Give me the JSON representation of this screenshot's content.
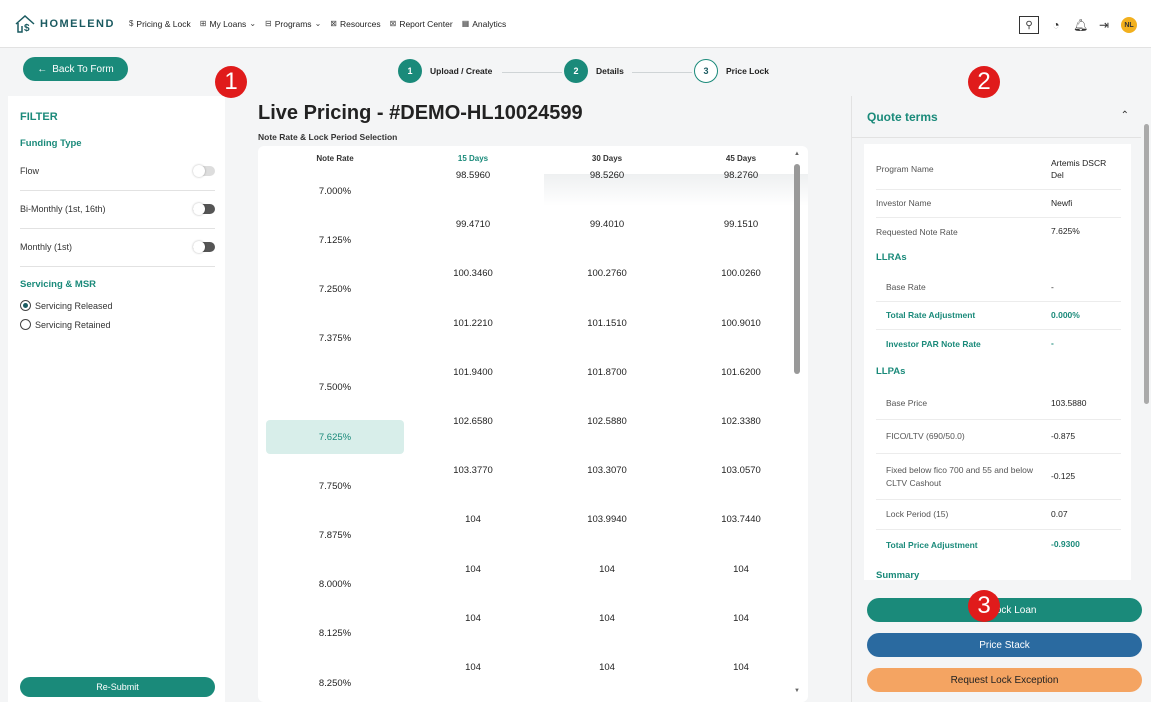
{
  "nav": {
    "logo_text": "HOMELEND",
    "items": [
      {
        "icon": "$",
        "label": "Pricing & Lock",
        "chevron": false
      },
      {
        "icon": "⊞",
        "label": "My Loans",
        "chevron": true
      },
      {
        "icon": "⊟",
        "label": "Programs",
        "chevron": true
      },
      {
        "icon": "⊠",
        "label": "Resources",
        "chevron": false
      },
      {
        "icon": "⊠",
        "label": "Report Center",
        "chevron": false
      },
      {
        "icon": "▦",
        "label": "Analytics",
        "chevron": false
      }
    ],
    "avatar_initials": "NL"
  },
  "stepper": {
    "back_label": "Back To Form",
    "steps": [
      {
        "num": "1",
        "label": "Upload / Create"
      },
      {
        "num": "2",
        "label": "Details"
      },
      {
        "num": "3",
        "label": "Price Lock"
      }
    ]
  },
  "markers": [
    "1",
    "2",
    "3"
  ],
  "filter": {
    "title": "FILTER",
    "funding_type": "Funding Type",
    "toggles": [
      "Flow",
      "Bi-Monthly (1st, 16th)",
      "Monthly (1st)"
    ],
    "servicing_title": "Servicing & MSR",
    "radios": [
      "Servicing Released",
      "Servicing Retained"
    ],
    "resubmit": "Re-Submit"
  },
  "pricing": {
    "title": "Live Pricing - #DEMO-HL10024599",
    "subtitle": "Note Rate & Lock Period Selection",
    "headers": [
      "Note Rate",
      "15 Days",
      "30 Days",
      "45 Days"
    ],
    "rows": [
      {
        "rate": "7.000%",
        "d15": "98.5960",
        "d30": "98.5260",
        "d45": "98.2760"
      },
      {
        "rate": "7.125%",
        "d15": "99.4710",
        "d30": "99.4010",
        "d45": "99.1510"
      },
      {
        "rate": "7.250%",
        "d15": "100.3460",
        "d30": "100.2760",
        "d45": "100.0260"
      },
      {
        "rate": "7.375%",
        "d15": "101.2210",
        "d30": "101.1510",
        "d45": "100.9010"
      },
      {
        "rate": "7.500%",
        "d15": "101.9400",
        "d30": "101.8700",
        "d45": "101.6200"
      },
      {
        "rate": "7.625%",
        "d15": "102.6580",
        "d30": "102.5880",
        "d45": "102.3380"
      },
      {
        "rate": "7.750%",
        "d15": "103.3770",
        "d30": "103.3070",
        "d45": "103.0570"
      },
      {
        "rate": "7.875%",
        "d15": "104",
        "d30": "103.9940",
        "d45": "103.7440"
      },
      {
        "rate": "8.000%",
        "d15": "104",
        "d30": "104",
        "d45": "104"
      },
      {
        "rate": "8.125%",
        "d15": "104",
        "d30": "104",
        "d45": "104"
      },
      {
        "rate": "8.250%",
        "d15": "104",
        "d30": "104",
        "d45": "104"
      }
    ]
  },
  "quote": {
    "title": "Quote terms",
    "program_name_label": "Program Name",
    "program_name_value": "Artemis DSCR Del",
    "investor_label": "Investor Name",
    "investor_value": "Newfi",
    "req_rate_label": "Requested Note Rate",
    "req_rate_value": "7.625%",
    "llras": "LLRAs",
    "base_rate_label": "Base Rate",
    "base_rate_value": "-",
    "total_rate_adj_label": "Total Rate Adjustment",
    "total_rate_adj_value": "0.000%",
    "par_label": "Investor PAR Note Rate",
    "par_value": "-",
    "llpas": "LLPAs",
    "base_price_label": "Base Price",
    "base_price_value": "103.5880",
    "fico_label": "FICO/LTV (690/50.0)",
    "fico_value": "-0.875",
    "fixed_label": "Fixed below fico 700 and 55 and below CLTV Cashout",
    "fixed_value": "-0.125",
    "lock_label": "Lock Period (15)",
    "lock_value": "0.07",
    "total_price_label": "Total Price Adjustment",
    "total_price_value": "-0.9300",
    "summary": "Summary"
  },
  "actions": {
    "lock_loan": "S      ock Loan",
    "price_stack": "Price Stack",
    "lock_exception": "Request Lock Exception"
  }
}
